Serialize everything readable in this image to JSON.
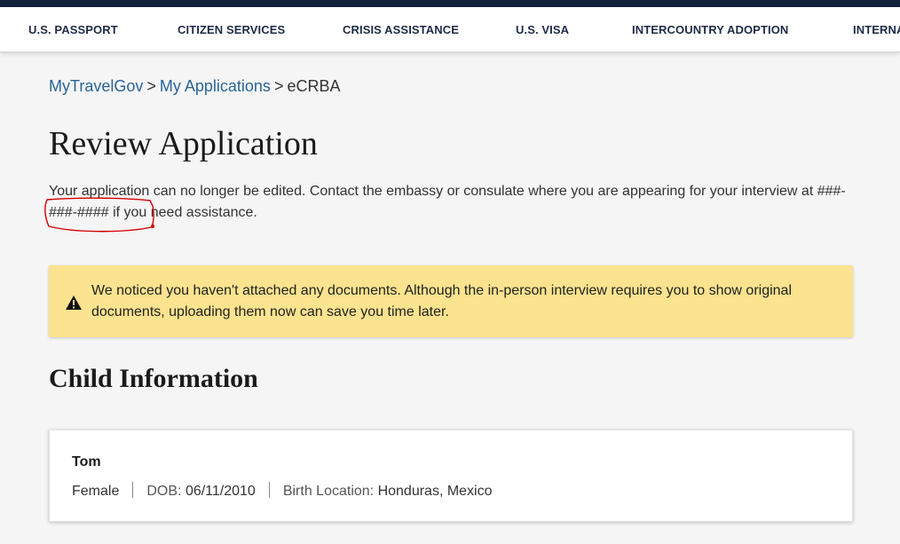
{
  "nav": {
    "items": [
      "U.S. PASSPORT",
      "CITIZEN SERVICES",
      "CRISIS ASSISTANCE",
      "U.S. VISA",
      "INTERCOUNTRY ADOPTION",
      "INTERNA"
    ]
  },
  "breadcrumb": {
    "home": "MyTravelGov",
    "sep1": ">",
    "applications": "My Applications",
    "sep2": ">",
    "current": "eCRBA"
  },
  "page": {
    "title": "Review Application",
    "notice_before": "Your application can no longer be edited. Contact the embassy or consulate where you are appearing for your interview at ",
    "phone": "###-###-####",
    "notice_after": " if you need assistance."
  },
  "alert": {
    "icon": "warning-icon",
    "text": "We noticed you haven't attached any documents. Although the in-person interview requires you to show original documents, uploading them now can save you time later."
  },
  "child_section": {
    "title": "Child Information",
    "name": "Tom",
    "sex": "Female",
    "dob_label": "DOB:",
    "dob": "06/11/2010",
    "birth_label": "Birth Location:",
    "birth_location": "Honduras, Mexico"
  },
  "colors": {
    "nav_bar": "#14213d",
    "link": "#2a6496",
    "alert_bg": "#fbe38f",
    "annotation": "#d40000"
  }
}
